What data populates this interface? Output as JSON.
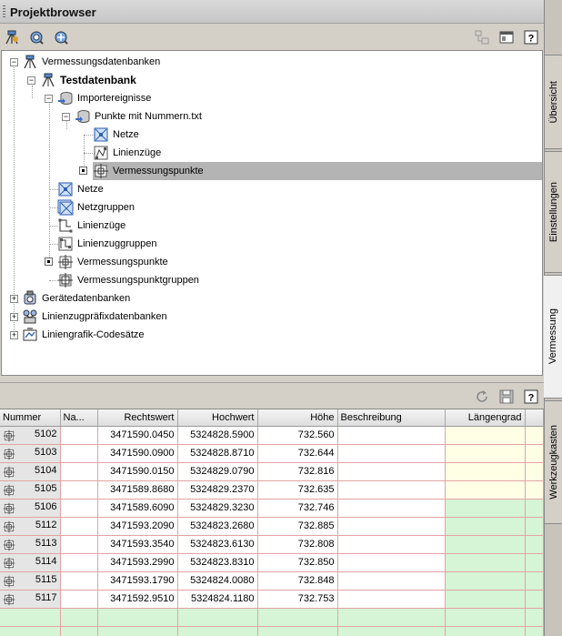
{
  "window": {
    "title": "Projektbrowser"
  },
  "side_tabs": [
    "Übersicht",
    "Einstellungen",
    "Vermessung",
    "Werkzeugkasten"
  ],
  "tree": {
    "root": "Vermessungsdatenbanken",
    "db": "Testdatenbank",
    "import": "Importereignisse",
    "file": "Punkte mit Nummern.txt",
    "file_netze": "Netze",
    "file_linienzuege": "Linienzüge",
    "file_punkte": "Vermessungspunkte",
    "netze": "Netze",
    "netzgruppen": "Netzgruppen",
    "linienzuege": "Linienzüge",
    "linienzuggruppen": "Linienzuggruppen",
    "punkte": "Vermessungspunkte",
    "punktgruppen": "Vermessungspunktgruppen",
    "geraete": "Gerätedatenbanken",
    "praefix": "Linienzugpräfixdatenbanken",
    "codesaetze": "Liniengrafik-Codesätze"
  },
  "table": {
    "headers": [
      "Nummer",
      "Na...",
      "Rechtswert",
      "Hochwert",
      "Höhe",
      "Beschreibung",
      "Längengrad"
    ],
    "rows": [
      [
        "5102",
        "",
        "3471590.0450",
        "5324828.5900",
        "732.560",
        "",
        ""
      ],
      [
        "5103",
        "",
        "3471590.0900",
        "5324828.8710",
        "732.644",
        "",
        ""
      ],
      [
        "5104",
        "",
        "3471590.0150",
        "5324829.0790",
        "732.816",
        "",
        ""
      ],
      [
        "5105",
        "",
        "3471589.8680",
        "5324829.2370",
        "732.635",
        "",
        ""
      ],
      [
        "5106",
        "",
        "3471589.6090",
        "5324829.3230",
        "732.746",
        "",
        ""
      ],
      [
        "5112",
        "",
        "3471593.2090",
        "5324823.2680",
        "732.885",
        "",
        ""
      ],
      [
        "5113",
        "",
        "3471593.3540",
        "5324823.6130",
        "732.808",
        "",
        ""
      ],
      [
        "5114",
        "",
        "3471593.2990",
        "5324823.8310",
        "732.850",
        "",
        ""
      ],
      [
        "5115",
        "",
        "3471593.1790",
        "5324824.0080",
        "732.848",
        "",
        ""
      ],
      [
        "5117",
        "",
        "3471592.9510",
        "5324824.1180",
        "732.753",
        "",
        ""
      ]
    ]
  },
  "icons": {
    "toolbar_top": [
      "survey-db-icon",
      "zoom-to-icon",
      "pan-to-icon"
    ],
    "toolbar_right": [
      "tree-view-icon",
      "panel-icon",
      "help-icon"
    ],
    "table_toolbar": [
      "refresh-icon",
      "save-icon",
      "help-icon"
    ]
  },
  "colors": {
    "selection": "#b4b4b4",
    "row_yellow": "#ffffe6",
    "row_green": "#d6f5d6",
    "grid_line": "#e3a3a3"
  }
}
